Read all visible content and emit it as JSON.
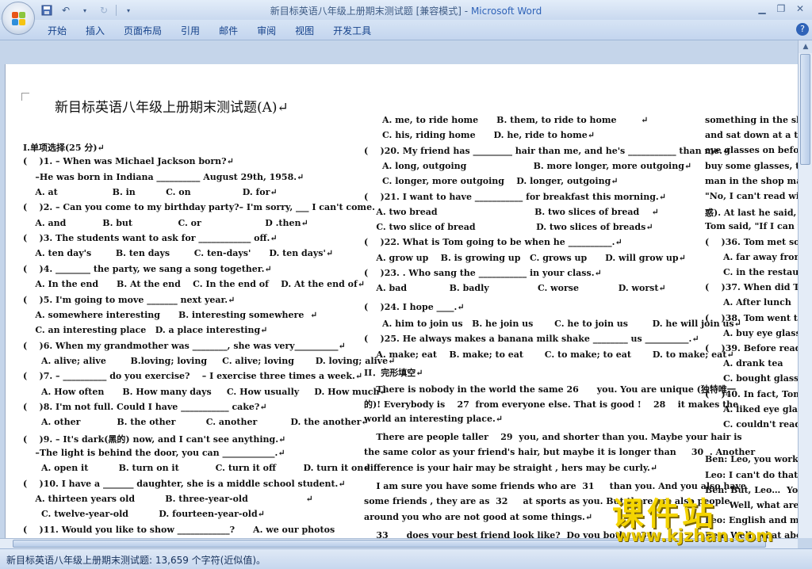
{
  "window": {
    "title_doc": "新目标英语八年级上册期末测试题 [兼容模式]",
    "title_sep": " - ",
    "title_app": "Microsoft Word"
  },
  "ribbon": {
    "tabs": [
      "开始",
      "插入",
      "页面布局",
      "引用",
      "邮件",
      "审阅",
      "视图",
      "开发工具"
    ]
  },
  "status": {
    "text": "新目标英语八年级上册期末测试题: 13,659 个字符(近似值)。"
  },
  "document": {
    "title": "新目标英语八年级上册期末测试题(A)↵",
    "col1": [
      "I.单项选择(25 分)↵",
      "(    )1. – When was Michael Jackson born?↵",
      "    –He was born in Indiana __________ August 29th, 1958.↵",
      "    A. at                  B. in          C. on                 D. for↵",
      "(    )2. – Can you come to my birthday party?– I'm sorry, ___ I can't come.",
      "    A. and            B. but               C. or                     D .then↵",
      "(    )3. The students want to ask for ____________ off.↵",
      "    A. ten day's        B. ten days        C. ten-days'      D. ten days'↵",
      "(    )4. ________ the party, we sang a song together.↵",
      "    A. In the end      B. At the end    C. In the end of    D. At the end of↵",
      "(    )5. I'm going to move _______ next year.↵",
      "    A. somewhere interesting      B. interesting somewhere  ↵",
      "    C. an interesting place   D. a place interesting↵",
      "(    )6. When my grandmother was ________, she was very__________↵",
      "      A. alive; alive        B.loving; loving     C. alive; loving       D. loving; alive↵",
      "(    )7. – __________ do you exercise?    – I exercise three times a week.↵",
      "      A. How often      B. How many days     C. How usually     D. How much↵",
      "(    )8. I'm not full. Could I have ___________ cake?↵",
      "      A. other            B. the other          C. another           D. the another↵",
      "(    )9. – It's dark(黑的) now, and I can't see anything.↵",
      "    –The light is behind the door, you can ____________.↵",
      "      A. open it          B. turn on it            C. turn it off         D. turn it on↵",
      "(    )10. I have a _______ daughter, she is a middle school student.↵",
      "    A. thirteen years old          B. three-year-old                   ↵",
      "      C. twelve-year-old          D. fourteen-year-old↵",
      "(    )11. Would you like to show ____________?      A. we our photos",
      "          B. your photoes to us?    C. your photos for us    D. us your photos↵"
    ],
    "col2": [
      "      A. me, to ride home      B. them, to ride to home        ↵",
      "      C. his, riding home      D. he, ride to home↵",
      "(    )20. My friend has _________ hair than me, and he's ___________ than me.↵",
      "      A. long, outgoing                      B. more longer, more outgoing↵",
      "      C. longer, more outgoing    D. longer, outgoing↵",
      "(    )21. I want to have ___________ for breakfast this morning.↵",
      "    A. two bread                                B. two slices of bread    ↵",
      "    C. two slice of bread                    D. two slices of breads↵",
      "(    )22. What is Tom going to be when he __________.↵",
      "    A. grow up    B. is growing up   C. grows up      D. will grow up↵",
      "(    )23. . Who sang the ___________ in your class.↵",
      "    A. bad              B. badly                C. worse             D. worst↵",
      "(    )24. I hope ____.↵",
      "      A. him to join us   B. he join us       C. he to join us        D. he will join us↵",
      "(    )25. He always makes a banana milk shake ________ us __________.↵",
      "    A. make; eat    B. make; to eat       C. to make; to eat       D. to make; eat↵",
      "II．完形填空↵",
      "    There is nobody in the world the same 26      you. You are unique (独特唯一",
      "的)! Everybody is    27  from everyone else. That is good !    28    it makes the",
      "world an interesting place.↵",
      "    There are people taller    29  you, and shorter than you. Maybe your hair is",
      "the same color as your friend's hair, but maybe it is longer than     30  . Another",
      "difference is your hair may be straight , hers may be curly.↵",
      "    I am sure you have some friends who are  31     than you. And you also have",
      "some friends , they are as  32     at sports as you. But there are also people",
      "around you who are not good at some things.↵",
      "    33      does your best friend look like?  Do you both     34   ",
      "homework at school? Do you both want to wear the same clothes every day?"
    ],
    "col3": [
      "something in the shop,",
      "and sat down at a tabl",
      "eye glasses on before re",
      "buy some glasses, too. I",
      "man in the shop made",
      "\"No, I can't read with",
      "惑). At last he said, \"E",
      "Tom said, \"If I can read",
      "(    )36. Tom met some o",
      "      A. far away from t",
      "      C. in the restauran",
      "(    )37. When did Tom g",
      "      A. After lunch     B.",
      "(    )38. Tom went to a re",
      "      A. buy eye glasses f",
      "(    )39. Before reading t",
      "      A. drank tea",
      "      C. bought glasses",
      "(    )40. In fact, Tom ___",
      "      A. liked eye glasses",
      "      C. couldn't read at",
      "",
      "Ben: Leo, you work too",
      "Leo: I can't do that. I h",
      "Ben: But, Leo…  You a",
      "        Well, what are yo",
      "Leo: English and mana",
      "Ben: Well, what about",
      "Leo: I'm very busy. I work"
    ]
  },
  "watermark": {
    "cn": "课件站",
    "url": "www.kjzhan.com"
  },
  "icons": {
    "office": "office-button-icon",
    "save": "save-icon",
    "undo": "undo-icon",
    "redo": "redo-icon",
    "customize": "customize-qat-icon",
    "help": "help-icon"
  }
}
